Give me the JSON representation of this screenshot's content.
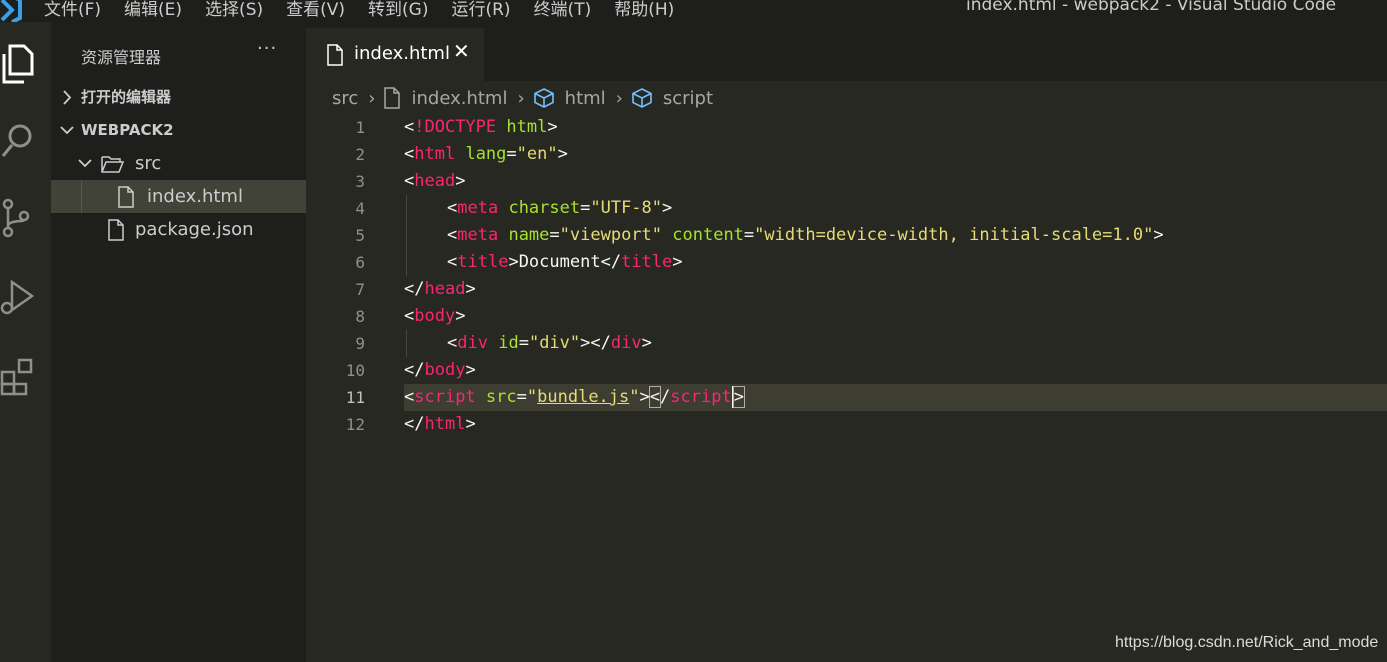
{
  "titlebar": {
    "menu": [
      "文件(F)",
      "编辑(E)",
      "选择(S)",
      "查看(V)",
      "转到(G)",
      "运行(R)",
      "终端(T)",
      "帮助(H)"
    ],
    "window_title": "index.html - webpack2 - Visual Studio Code"
  },
  "activity_bar": {
    "items": [
      "explorer-icon",
      "search-icon",
      "source-control-icon",
      "run-debug-icon",
      "extensions-icon"
    ]
  },
  "sidebar": {
    "title": "资源管理器",
    "more": "···",
    "open_editors": "打开的编辑器",
    "workspace": "WEBPACK2",
    "tree": [
      {
        "label": "src",
        "type": "folder",
        "expanded": true
      },
      {
        "label": "index.html",
        "type": "file",
        "selected": true
      },
      {
        "label": "package.json",
        "type": "file"
      }
    ]
  },
  "editor": {
    "tab": {
      "label": "index.html",
      "close": "✕"
    },
    "breadcrumb": [
      "src",
      "index.html",
      "html",
      "script"
    ],
    "line_numbers": [
      "1",
      "2",
      "3",
      "4",
      "5",
      "6",
      "7",
      "8",
      "9",
      "10",
      "11",
      "12"
    ],
    "code": {
      "l1": {
        "a": "<",
        "b": "!DOCTYPE",
        "c": " ",
        "d": "html",
        "e": ">"
      },
      "l2": {
        "a": "<",
        "b": "html",
        "c": " ",
        "d": "lang",
        "e": "=",
        "f": "\"en\"",
        "g": ">"
      },
      "l3": {
        "a": "<",
        "b": "head",
        "c": ">"
      },
      "l4": {
        "a": "<",
        "b": "meta",
        "c": " ",
        "d": "charset",
        "e": "=",
        "f": "\"UTF-8\"",
        "g": ">"
      },
      "l5": {
        "a": "<",
        "b": "meta",
        "c": " ",
        "d": "name",
        "e": "=",
        "f": "\"viewport\"",
        "g": " ",
        "h": "content",
        "i": "=",
        "j": "\"width=device-width, initial-scale=1.0\"",
        "k": ">"
      },
      "l6": {
        "a": "<",
        "b": "title",
        "c": ">",
        "d": "Document",
        "e": "</",
        "f": "title",
        "g": ">"
      },
      "l7": {
        "a": "</",
        "b": "head",
        "c": ">"
      },
      "l8": {
        "a": "<",
        "b": "body",
        "c": ">"
      },
      "l9": {
        "a": "<",
        "b": "div",
        "c": " ",
        "d": "id",
        "e": "=",
        "f": "\"div\"",
        "g": "></",
        "h": "div",
        "i": ">"
      },
      "l10": {
        "a": "</",
        "b": "body",
        "c": ">"
      },
      "l11": {
        "a": "<",
        "b": "script",
        "c": " ",
        "d": "src",
        "e": "=",
        "f": "\"",
        "g": "bundle.js",
        "h": "\"",
        "i": ">",
        "j": "<",
        "k": "/",
        "l": "script",
        "m": ">"
      },
      "l12": {
        "a": "</",
        "b": "html",
        "c": ">"
      }
    }
  },
  "watermark": "https://blog.csdn.net/Rick_and_mode",
  "colors": {
    "tag": "#f92672",
    "attr": "#a6e22e",
    "string": "#e6db74",
    "background": "#272822"
  }
}
